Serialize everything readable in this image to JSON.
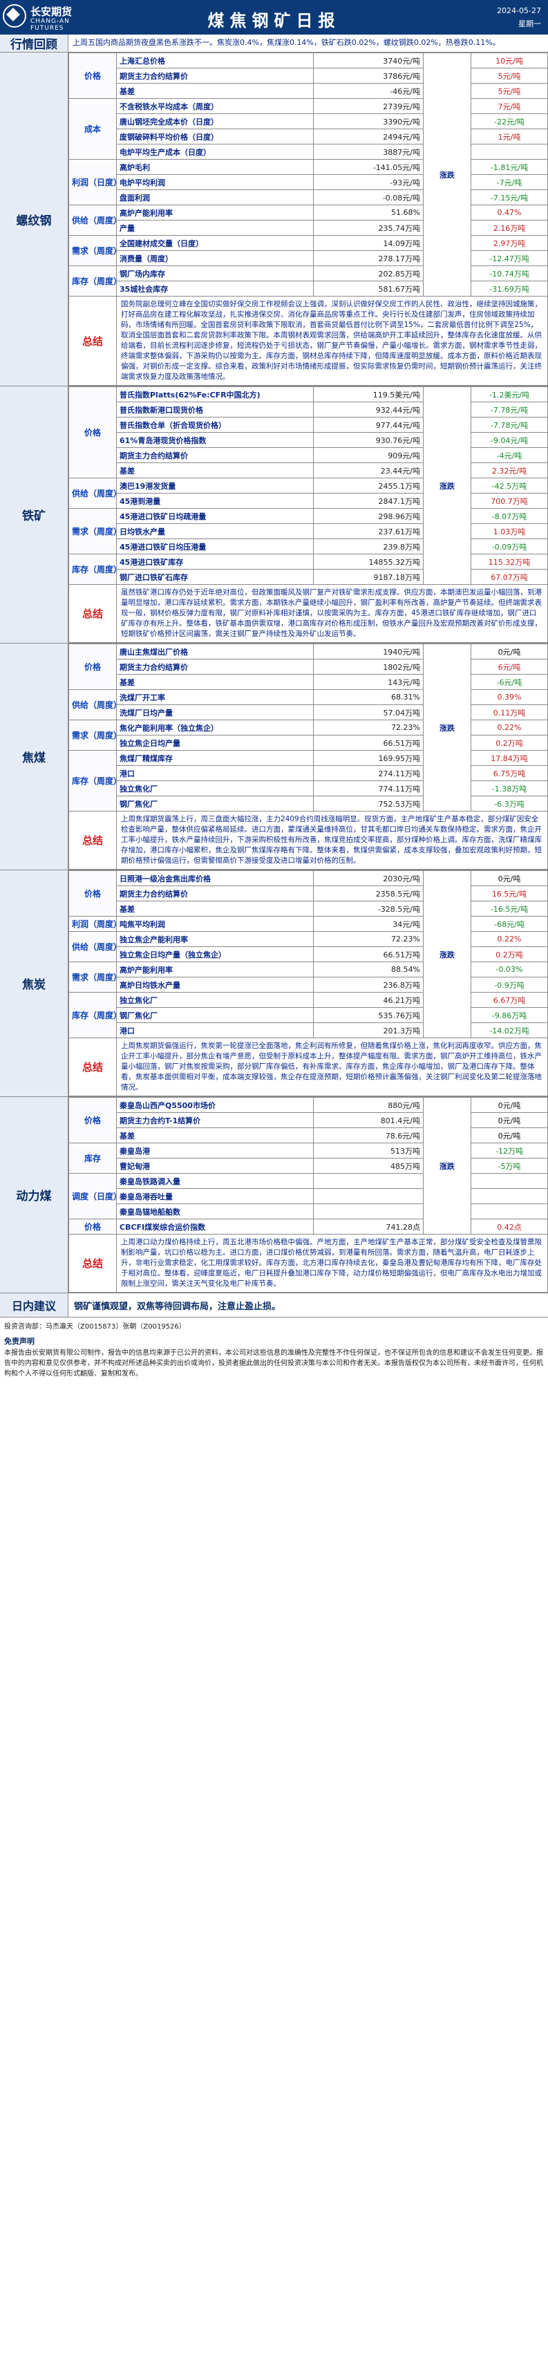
{
  "header": {
    "company": "长安期货",
    "company_en": "CHANG-AN FUTURES",
    "title": "煤焦钢矿日报",
    "date": "2024-05-27",
    "weekday": "星期一"
  },
  "review": {
    "label": "行情回顾",
    "text": "上周五国内商品期货夜盘黑色系涨跌不一。焦炭涨0.4%，焦煤涨0.14%，铁矿石跌0.02%，螺纹钢跌0.02%，热卷跌0.11%。"
  },
  "sections": [
    {
      "name": "螺纹钢",
      "trend": "涨跌",
      "groups": [
        {
          "name": "价格",
          "rows": [
            {
              "label": "上海汇总价格",
              "value": "3740元/吨",
              "change": "10元/吨",
              "dir": "up"
            },
            {
              "label": "期货主力合约结算价",
              "value": "3786元/吨",
              "change": "5元/吨",
              "dir": "up"
            },
            {
              "label": "基差",
              "value": "-46元/吨",
              "change": "5元/吨",
              "dir": "up"
            }
          ]
        },
        {
          "name": "成本",
          "rows": [
            {
              "label": "不含税铁水平均成本（周度）",
              "value": "2739元/吨",
              "change": "7元/吨",
              "dir": "up"
            },
            {
              "label": "唐山钢坯完全成本价（日度）",
              "value": "3390元/吨",
              "change": "-22元/吨",
              "dir": "down"
            },
            {
              "label": "废钢破碎料平均价格（日度）",
              "value": "2494元/吨",
              "change": "1元/吨",
              "dir": "up"
            },
            {
              "label": "电炉平均生产成本（日度）",
              "value": "3887元/吨",
              "change": "",
              "dir": ""
            }
          ]
        },
        {
          "name": "利润（日度）",
          "rows": [
            {
              "label": "高炉毛利",
              "value": "-141.05元/吨",
              "change": "-1.81元/吨",
              "dir": "down"
            },
            {
              "label": "电炉平均利润",
              "value": "-93元/吨",
              "change": "-7元/吨",
              "dir": "down"
            },
            {
              "label": "盘面利润",
              "value": "-0.08元/吨",
              "change": "-7.15元/吨",
              "dir": "down"
            }
          ]
        },
        {
          "name": "供给（周度）",
          "rows": [
            {
              "label": "高炉产能利用率",
              "value": "51.68%",
              "change": "0.47%",
              "dir": "up"
            },
            {
              "label": "产量",
              "value": "235.74万吨",
              "change": "2.16万吨",
              "dir": "up"
            }
          ]
        },
        {
          "name": "需求（周度）",
          "rows": [
            {
              "label": "全国建材成交量（日度）",
              "value": "14.09万吨",
              "change": "2.97万吨",
              "dir": "up"
            },
            {
              "label": "消费量（周度）",
              "value": "278.17万吨",
              "change": "-12.47万吨",
              "dir": "down"
            }
          ]
        },
        {
          "name": "库存（周度）",
          "rows": [
            {
              "label": "钢厂场内库存",
              "value": "202.85万吨",
              "change": "-10.74万吨",
              "dir": "down"
            },
            {
              "label": "35城社会库存",
              "value": "581.67万吨",
              "change": "-31.69万吨",
              "dir": "down"
            }
          ]
        }
      ],
      "summary_label": "总结",
      "summary": "国务院副总理何立峰在全国切实做好保交房工作视频会议上强调，深刻认识做好保交房工作的人民性、政治性，继续坚持因城施策，打好商品房在建工程化解攻坚战，扎实推进保交房、消化存量商品房等重点工作。央行行长及住建部门发声，住房领域政策持续加码，市场情绪有所回暖。全国首套房贷利率政策下限取消，首套商贷最低首付比例下调至15%，二套房最低首付比例下调至25%，取消全国层面首套和二套房贷款利率政策下限。本周钢材表观需求回落，供给端高炉开工率延续回升，整体库存去化速度放缓。从供给端看，目前长流程利润逐步修复，短流程仍处于亏损状态，钢厂复产节奏偏慢，产量小幅增长。需求方面，钢材需求季节性走弱，终端需求整体偏弱，下游采购仍以按需为主。库存方面，钢材总库存持续下降，但降库速度明显放缓。成本方面，原料价格近期表现偏强，对钢价形成一定支撑。综合来看，政策利好对市场情绪形成提振，但实际需求恢复仍需时间，短期钢价预计震荡运行，关注终端需求恢复力度及政策落地情况。"
    },
    {
      "name": "铁矿",
      "trend": "涨跌",
      "groups": [
        {
          "name": "价格",
          "rows": [
            {
              "label": "普氏指数Platts(62%Fe:CFR中国北方)",
              "value": "119.5美元/吨",
              "change": "-1.2美元/吨",
              "dir": "down"
            },
            {
              "label": "普氏指数新港口现货价格",
              "value": "932.44元/吨",
              "change": "-7.78元/吨",
              "dir": "down"
            },
            {
              "label": "普氏指数仓单（折合现货价格）",
              "value": "977.44元/吨",
              "change": "-7.78元/吨",
              "dir": "down"
            },
            {
              "label": "61%青岛港现货价格指数",
              "value": "930.76元/吨",
              "change": "-9.04元/吨",
              "dir": "down"
            },
            {
              "label": "期货主力合约结算价",
              "value": "909元/吨",
              "change": "-4元/吨",
              "dir": "down"
            },
            {
              "label": "基差",
              "value": "23.44元/吨",
              "change": "2.32元/吨",
              "dir": "up"
            }
          ]
        },
        {
          "name": "供给（周度）",
          "rows": [
            {
              "label": "澳巴19港发货量",
              "value": "2455.1万吨",
              "change": "-42.5万吨",
              "dir": "down"
            },
            {
              "label": "45港到港量",
              "value": "2847.1万吨",
              "change": "700.7万吨",
              "dir": "up"
            }
          ]
        },
        {
          "name": "需求（周度）",
          "rows": [
            {
              "label": "45港进口铁矿日均疏港量",
              "value": "298.96万吨",
              "change": "-8.07万吨",
              "dir": "down"
            },
            {
              "label": "日均铁水产量",
              "value": "237.61万吨",
              "change": "1.03万吨",
              "dir": "up"
            },
            {
              "label": "45港进口铁矿日均压港量",
              "value": "239.8万吨",
              "change": "-0.09万吨",
              "dir": "down"
            }
          ]
        },
        {
          "name": "库存（周度）",
          "rows": [
            {
              "label": "45港进口铁矿库存",
              "value": "14855.32万吨",
              "change": "115.32万吨",
              "dir": "up"
            },
            {
              "label": "钢厂进口铁矿石库存",
              "value": "9187.18万吨",
              "change": "67.07万吨",
              "dir": "up"
            }
          ]
        }
      ],
      "summary_label": "总结",
      "summary": "虽然铁矿港口库存仍处于近年绝对高位，但政策面暖风及钢厂复产对铁矿需求形成支撑。供应方面，本期澳巴发运量小幅回落，到港量明显增加，港口库存延续累积。需求方面，本期铁水产量继续小幅回升，钢厂盈利率有所改善，高炉复产节奏延续。但终端需求表现一般，钢材价格反弹力度有限，钢厂对原料补库相对谨慎，以按需采购为主。库存方面，45港进口铁矿库存继续增加，钢厂进口矿库存亦有所上升。整体看，铁矿基本面供需双增，港口高库存对价格形成压制，但铁水产量回升及宏观预期改善对矿价形成支撑，短期铁矿价格预计区间震荡，需关注钢厂复产持续性及海外矿山发运节奏。"
    },
    {
      "name": "焦煤",
      "trend": "涨跌",
      "groups": [
        {
          "name": "价格",
          "rows": [
            {
              "label": "唐山主焦煤出厂价格",
              "value": "1940元/吨",
              "change": "0元/吨",
              "dir": ""
            },
            {
              "label": "期货主力合约结算价",
              "value": "1802元/吨",
              "change": "6元/吨",
              "dir": "up"
            },
            {
              "label": "基差",
              "value": "143元/吨",
              "change": "-6元/吨",
              "dir": "down"
            }
          ]
        },
        {
          "name": "供给（周度）",
          "rows": [
            {
              "label": "洗煤厂开工率",
              "value": "68.31%",
              "change": "0.39%",
              "dir": "up"
            },
            {
              "label": "洗煤厂日均产量",
              "value": "57.04万吨",
              "change": "0.11万吨",
              "dir": "up"
            }
          ]
        },
        {
          "name": "需求（周度）",
          "rows": [
            {
              "label": "焦化产能利用率（独立焦企）",
              "value": "72.23%",
              "change": "0.22%",
              "dir": "up"
            },
            {
              "label": "独立焦企日均产量",
              "value": "66.51万吨",
              "change": "0.2万吨",
              "dir": "up"
            }
          ]
        },
        {
          "name": "库存（周度）",
          "rows": [
            {
              "label": "焦煤厂精煤库存",
              "value": "169.95万吨",
              "change": "17.84万吨",
              "dir": "up"
            },
            {
              "label": "港口",
              "value": "274.11万吨",
              "change": "6.75万吨",
              "dir": "up"
            },
            {
              "label": "独立焦化厂",
              "value": "774.11万吨",
              "change": "-1.38万吨",
              "dir": "down"
            },
            {
              "label": "钢厂焦化厂",
              "value": "752.53万吨",
              "change": "-6.3万吨",
              "dir": "down"
            }
          ]
        }
      ],
      "summary_label": "总结",
      "summary": "上周焦煤期货震荡上行，周三盘面大幅拉涨，主力2409合约周线涨幅明显。现货方面，主产地煤矿生产基本稳定，部分煤矿因安全检查影响产量，整体供应偏紧格局延续。进口方面，蒙煤通关量维持高位，甘其毛都口岸日均通关车数保持稳定。需求方面，焦企开工率小幅提升，铁水产量持续回升，下游采购积极性有所改善，焦煤竞拍成交率提高，部分煤种价格上调。库存方面，洗煤厂精煤库存增加，港口库存小幅累积，焦企及钢厂焦煤库存略有下降。整体来看，焦煤供需偏紧，成本支撑较强，叠加宏观政策利好预期，短期价格预计偏强运行，但需警惕高价下游接受度及进口增量对价格的压制。"
    },
    {
      "name": "焦炭",
      "trend": "涨跌",
      "groups": [
        {
          "name": "价格",
          "rows": [
            {
              "label": "日照港一级冶金焦出库价格",
              "value": "2030元/吨",
              "change": "0元/吨",
              "dir": ""
            },
            {
              "label": "期货主力合约结算价",
              "value": "2358.5元/吨",
              "change": "16.5元/吨",
              "dir": "up"
            },
            {
              "label": "基差",
              "value": "-328.5元/吨",
              "change": "-16.5元/吨",
              "dir": "down"
            }
          ]
        },
        {
          "name": "利润（周度）",
          "rows": [
            {
              "label": "吨焦平均利润",
              "value": "34元/吨",
              "change": "-68元/吨",
              "dir": "down"
            }
          ]
        },
        {
          "name": "供给（周度）",
          "rows": [
            {
              "label": "独立焦企产能利用率",
              "value": "72.23%",
              "change": "0.22%",
              "dir": "up"
            },
            {
              "label": "独立焦企日均产量（独立焦企）",
              "value": "66.51万吨",
              "change": "0.2万吨",
              "dir": "up"
            }
          ]
        },
        {
          "name": "需求（周度）",
          "rows": [
            {
              "label": "高炉产能利用率",
              "value": "88.54%",
              "change": "-0.03%",
              "dir": "down"
            },
            {
              "label": "高炉日均铁水产量",
              "value": "236.8万吨",
              "change": "-0.9万吨",
              "dir": "down"
            }
          ]
        },
        {
          "name": "库存（周度）",
          "rows": [
            {
              "label": "独立焦化厂",
              "value": "46.21万吨",
              "change": "6.67万吨",
              "dir": "up"
            },
            {
              "label": "钢厂焦化厂",
              "value": "535.76万吨",
              "change": "-9.86万吨",
              "dir": "down"
            },
            {
              "label": "港口",
              "value": "201.3万吨",
              "change": "-14.02万吨",
              "dir": "down"
            }
          ]
        }
      ],
      "summary_label": "总结",
      "summary": "上周焦炭期货偏强运行，焦炭第一轮提涨已全面落地，焦企利润有所修复，但随着焦煤价格上涨，焦化利润再度收窄。供应方面，焦企开工率小幅提升，部分焦企有增产意愿，但受制于原料成本上升，整体提产幅度有限。需求方面，钢厂高炉开工维持高位，铁水产量小幅回落，钢厂对焦炭按需采购，部分钢厂库存偏低，有补库需求。库存方面，焦企库存小幅增加，钢厂及港口库存下降。整体看，焦炭基本面供需相对平衡，成本端支撑较强，焦企存在提涨预期，短期价格预计震荡偏强，关注钢厂利润变化及第二轮提涨落地情况。"
    },
    {
      "name": "动力煤",
      "trend": "涨跌",
      "groups": [
        {
          "name": "价格",
          "rows": [
            {
              "label": "秦皇岛山西产Q5500市场价",
              "value": "880元/吨",
              "change": "0元/吨",
              "dir": ""
            },
            {
              "label": "期货主力合约T-1结算价",
              "value": "801.4元/吨",
              "change": "0元/吨",
              "dir": ""
            },
            {
              "label": "基差",
              "value": "78.6元/吨",
              "change": "0元/吨",
              "dir": ""
            }
          ]
        },
        {
          "name": "库存",
          "rows": [
            {
              "label": "秦皇岛港",
              "value": "513万吨",
              "change": "-12万吨",
              "dir": "down"
            },
            {
              "label": "曹妃甸港",
              "value": "485万吨",
              "change": "-5万吨",
              "dir": "down"
            }
          ]
        },
        {
          "name": "调度（日度）",
          "rows": [
            {
              "label": "秦皇岛铁路调入量",
              "value": "",
              "change": "",
              "dir": ""
            },
            {
              "label": "秦皇岛港吞吐量",
              "value": "",
              "change": "",
              "dir": ""
            },
            {
              "label": "秦皇岛锚地船舶数",
              "value": "",
              "change": "",
              "dir": ""
            }
          ]
        },
        {
          "name": "价格",
          "rows": [
            {
              "label": "CBCFI煤炭综合运价指数",
              "value": "741.28点",
              "change": "0.42点",
              "dir": "up"
            }
          ]
        }
      ],
      "summary_label": "总结",
      "summary": "上周港口动力煤价格持续上行，周五北港市场价格稳中偏强。产地方面，主产地煤矿生产基本正常，部分煤矿受安全检查及煤管票限制影响产量，坑口价格以稳为主。进口方面，进口煤价格优势减弱，到港量有所回落。需求方面，随着气温升高，电厂日耗逐步上升，非电行业需求稳定，化工用煤需求较好。库存方面，北方港口库存持续去化，秦皇岛港及曹妃甸港库存均有所下降，电厂库存处于相对高位。整体看，迎峰度夏临近，电厂日耗提升叠加港口库存下降，动力煤价格短期偏强运行，但电厂高库存及水电出力增加或限制上涨空间，需关注天气变化及电厂补库节奏。"
    }
  ],
  "advice": {
    "label": "日内建议",
    "text": "钢矿谨慎观望，双焦等待回调布局，注意止盈止损。"
  },
  "analyst": "投资咨询部：马杰瀛天（Z0015873）张朝（Z0019526）",
  "disclaimer": {
    "title": "免责声明",
    "text": "本报告由长安期货有限公司制作，报告中的信息均来源于已公开的资料，本公司对这些信息的准确性及完整性不作任何保证，也不保证所包含的信息和建议不会发生任何变更。报告中的内容和意见仅供参考，并不构成对所述品种买卖的出价或询价，投资者据此做出的任何投资决策与本公司和作者无关。本报告版权仅为本公司所有，未经书面许可，任何机构和个人不得以任何形式翻版、复制和发布。"
  },
  "colors": {
    "header_bg": "#0c3a78",
    "label_text": "#0d2a8a",
    "summary_label": "#d42020",
    "up": "#c42020",
    "down": "#178a2a"
  }
}
